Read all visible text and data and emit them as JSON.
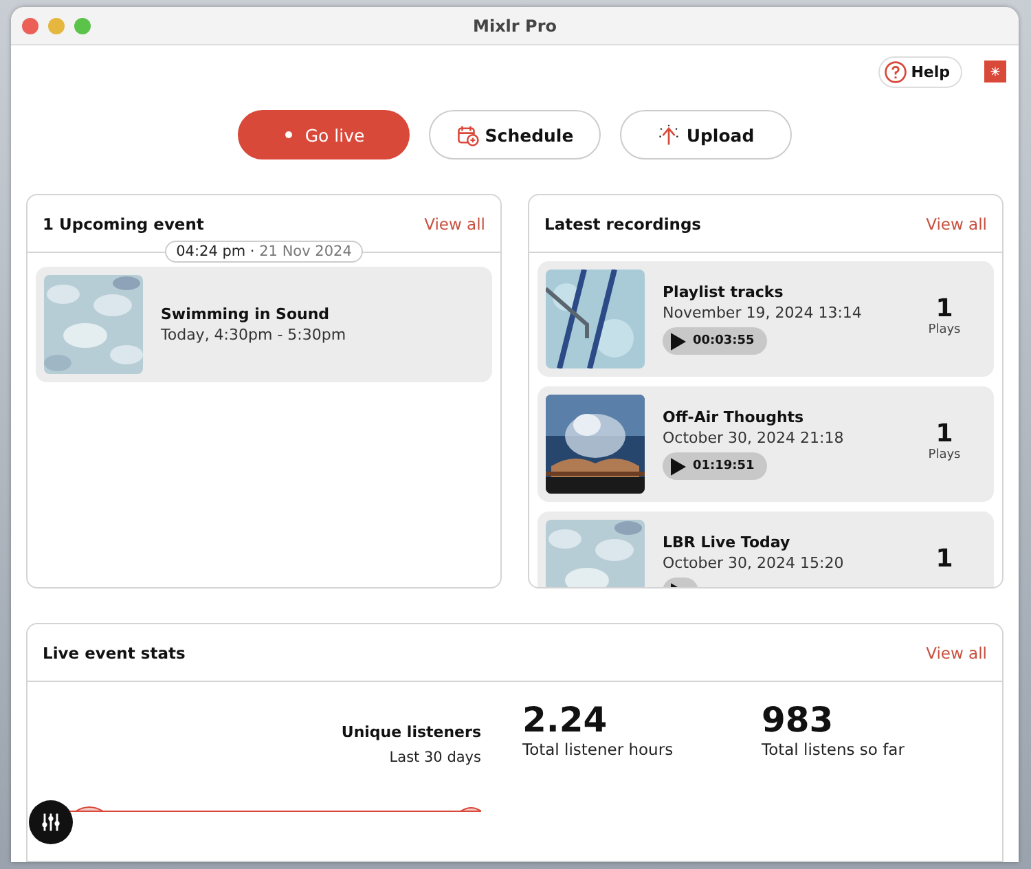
{
  "window": {
    "title": "Mixlr Pro"
  },
  "help": {
    "label": "Help"
  },
  "actions": [
    {
      "kind": "live",
      "label": "Go live"
    },
    {
      "kind": "schedule",
      "label": "Schedule"
    },
    {
      "kind": "upload",
      "label": "Upload"
    }
  ],
  "upcoming": {
    "title": "1 Upcoming event",
    "view_all": "View all",
    "time": "04:24 pm ·",
    "date": "21 Nov 2024",
    "events": [
      {
        "title": "Swimming in Sound",
        "when": "Today, 4:30pm - 5:30pm"
      }
    ]
  },
  "recordings": {
    "title": "Latest recordings",
    "view_all": "View all",
    "items": [
      {
        "title": "Playlist tracks",
        "date": "November 19, 2024 13:14",
        "duration": "00:03:55",
        "plays": "1",
        "plays_label": "Plays"
      },
      {
        "title": "Off-Air Thoughts",
        "date": "October 30, 2024 21:18",
        "duration": "01:19:51",
        "plays": "1",
        "plays_label": "Plays"
      },
      {
        "title": "LBR Live Today",
        "date": "October 30, 2024 15:20",
        "plays": "1"
      }
    ]
  },
  "stats": {
    "title": "Live event stats",
    "view_all": "View all",
    "chart_title": "Unique listeners",
    "chart_period": "Last 30 days",
    "figures": [
      {
        "value": "2.24",
        "label": "Total listener hours"
      },
      {
        "value": "983",
        "label": "Total listens so far"
      }
    ]
  }
}
